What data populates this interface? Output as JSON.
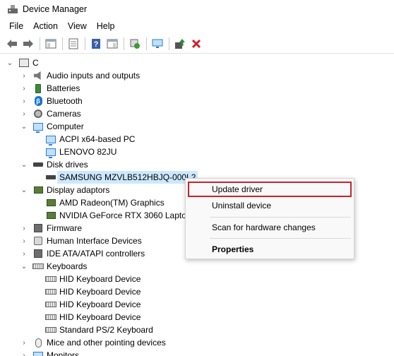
{
  "window": {
    "title": "Device Manager",
    "app_icon": "device-manager-icon"
  },
  "menu": [
    "File",
    "Action",
    "View",
    "Help"
  ],
  "toolbar": {
    "buttons": [
      "back-arrow-icon",
      "forward-arrow-icon",
      "show-hide-tree-icon",
      "properties-icon",
      "help-icon",
      "action-pane-icon",
      "scan-hardware-icon",
      "monitor-icon",
      "update-driver-icon",
      "uninstall-icon"
    ],
    "colors": {
      "back": "#5a5a5a",
      "uninstall": "#d0202a",
      "update": "#2a8a3a"
    }
  },
  "tree": {
    "root": "C",
    "items": [
      {
        "label": "Audio inputs and outputs",
        "icon": "speaker-icon",
        "expander": "collapsed"
      },
      {
        "label": "Batteries",
        "icon": "battery-icon",
        "expander": "collapsed"
      },
      {
        "label": "Bluetooth",
        "icon": "bluetooth-icon",
        "expander": "collapsed"
      },
      {
        "label": "Cameras",
        "icon": "camera-icon",
        "expander": "collapsed"
      },
      {
        "label": "Computer",
        "icon": "monitor-icon",
        "expander": "expanded"
      },
      {
        "label": "ACPI x64-based PC",
        "icon": "monitor-icon",
        "expander": "none"
      },
      {
        "label": "LENOVO 82JU",
        "icon": "monitor-icon",
        "expander": "none"
      },
      {
        "label": "Disk drives",
        "icon": "disk-icon",
        "expander": "expanded"
      },
      {
        "label": "SAMSUNG MZVLB512HBJQ-000L2",
        "icon": "disk-icon",
        "expander": "none",
        "selected": true
      },
      {
        "label": "Display adaptors",
        "icon": "display-adapter-icon",
        "expander": "expanded"
      },
      {
        "label": "AMD Radeon(TM) Graphics",
        "icon": "display-adapter-icon",
        "expander": "none"
      },
      {
        "label": "NVIDIA GeForce RTX 3060 Laptop",
        "icon": "display-adapter-icon",
        "expander": "none"
      },
      {
        "label": "Firmware",
        "icon": "chip-icon",
        "expander": "collapsed"
      },
      {
        "label": "Human Interface Devices",
        "icon": "hid-icon",
        "expander": "collapsed"
      },
      {
        "label": "IDE ATA/ATAPI controllers",
        "icon": "ide-icon",
        "expander": "collapsed"
      },
      {
        "label": "Keyboards",
        "icon": "keyboard-icon",
        "expander": "expanded"
      },
      {
        "label": "HID Keyboard Device",
        "icon": "keyboard-icon",
        "expander": "none"
      },
      {
        "label": "HID Keyboard Device",
        "icon": "keyboard-icon",
        "expander": "none"
      },
      {
        "label": "HID Keyboard Device",
        "icon": "keyboard-icon",
        "expander": "none"
      },
      {
        "label": "HID Keyboard Device",
        "icon": "keyboard-icon",
        "expander": "none"
      },
      {
        "label": "Standard PS/2 Keyboard",
        "icon": "keyboard-icon",
        "expander": "none"
      },
      {
        "label": "Mice and other pointing devices",
        "icon": "mouse-icon",
        "expander": "collapsed"
      },
      {
        "label": "Monitors",
        "icon": "monitor-icon",
        "expander": "collapsed"
      }
    ]
  },
  "context_menu": {
    "items": [
      {
        "label": "Update driver",
        "highlighted": true,
        "bold": false
      },
      {
        "label": "Uninstall device",
        "highlighted": false,
        "bold": false
      },
      {
        "label": "Scan for hardware changes",
        "highlighted": false,
        "bold": false
      },
      {
        "label": "Properties",
        "highlighted": false,
        "bold": true
      }
    ],
    "highlight_color": "#d0202a"
  }
}
